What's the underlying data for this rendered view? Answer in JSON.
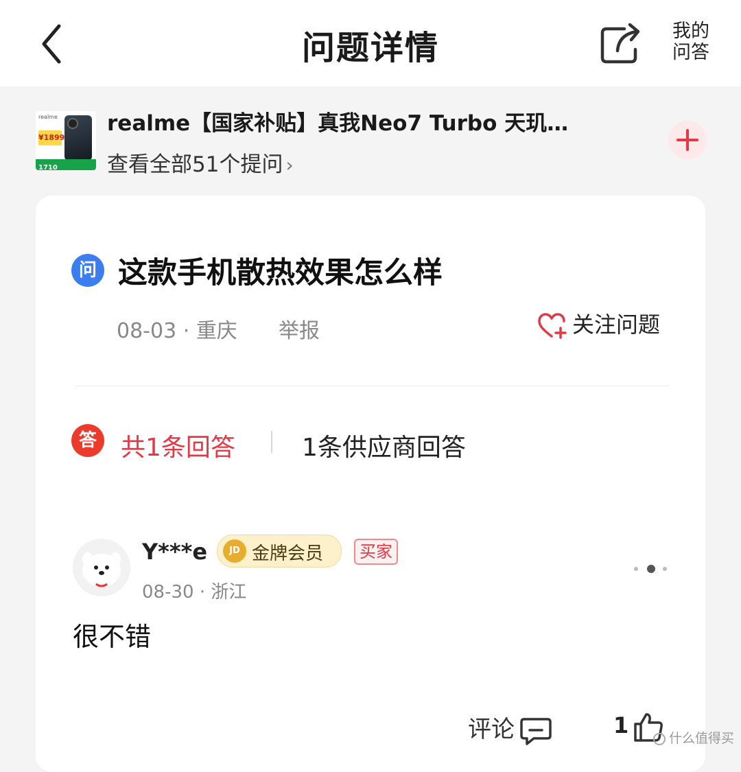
{
  "header": {
    "title": "问题详情",
    "my_qa_line1": "我的",
    "my_qa_line2": "问答"
  },
  "product": {
    "name": "realme【国家补贴】真我Neo7 Turbo 天玑…",
    "view_all": "查看全部51个提问",
    "thumb_brand": "realme",
    "thumb_price": "¥1899",
    "thumb_bottom": "1710"
  },
  "question": {
    "icon_text": "问",
    "title": "这款手机散热效果怎么样",
    "date": "08-03",
    "location": "重庆",
    "report_label": "举报",
    "follow_label": "关注问题"
  },
  "answers_tabs": {
    "icon_text": "答",
    "total_label": "共1条回答",
    "supplier_label": "1条供应商回答"
  },
  "answer": {
    "username": "Y***e",
    "badge_icon_text": "JD",
    "badge_label": "金牌会员",
    "buyer_label": "买家",
    "date": "08-30",
    "location": "浙江",
    "text": "很不错",
    "comment_label": "评论",
    "like_count": "1"
  },
  "watermark": {
    "text": "什么值得买"
  },
  "colors": {
    "accent_red": "#e53845",
    "question_blue": "#3c7ef0",
    "gold": "#e7ad2f"
  }
}
